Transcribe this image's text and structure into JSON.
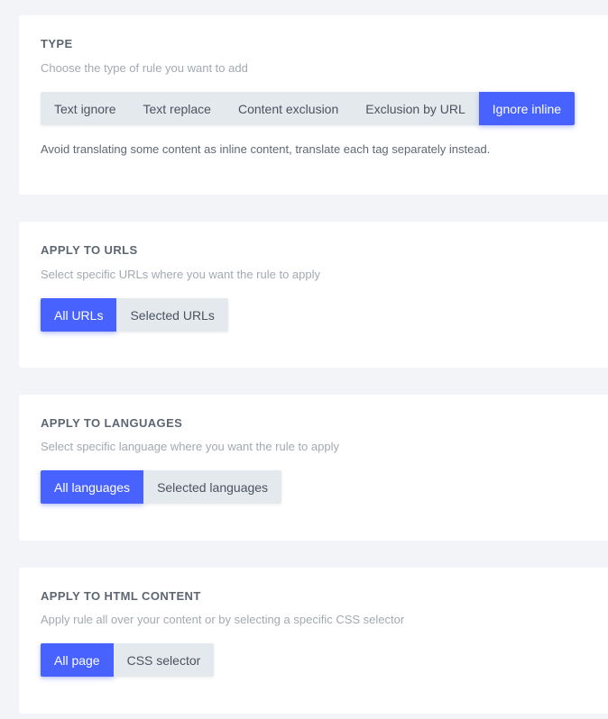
{
  "type_section": {
    "title": "TYPE",
    "description": "Choose the type of rule you want to add",
    "options": [
      "Text ignore",
      "Text replace",
      "Content exclusion",
      "Exclusion by URL",
      "Ignore inline"
    ],
    "selected": "Ignore inline",
    "note": "Avoid translating some content as inline content, translate each tag separately instead."
  },
  "urls_section": {
    "title": "APPLY TO URLS",
    "description": "Select specific URLs where you want the rule to apply",
    "options": [
      "All URLs",
      "Selected URLs"
    ],
    "selected": "All URLs"
  },
  "languages_section": {
    "title": "APPLY TO LANGUAGES",
    "description": "Select specific language where you want the rule to apply",
    "options": [
      "All languages",
      "Selected languages"
    ],
    "selected": "All languages"
  },
  "html_section": {
    "title": "APPLY TO HTML CONTENT",
    "description": "Apply rule all over your content or by selecting a specific CSS selector",
    "options": [
      "All page",
      "CSS selector"
    ],
    "selected": "All page"
  },
  "colors": {
    "accent": "#4762ff",
    "inactive_button": "#e4e9ee",
    "background": "#f3f4f7"
  }
}
